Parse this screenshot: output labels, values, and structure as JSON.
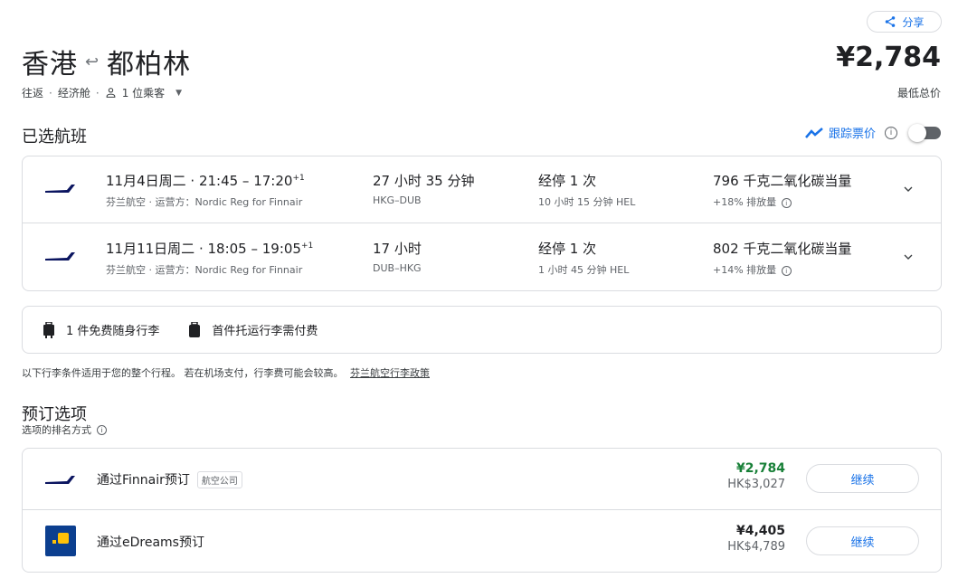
{
  "header": {
    "share_label": "分享",
    "origin": "香港",
    "destination": "都柏林",
    "total_price": "¥2,784",
    "total_price_label": "最低总价"
  },
  "trip": {
    "type": "往返",
    "cabin": "经济舱",
    "passengers": "1 位乘客"
  },
  "selected_flights": {
    "title": "已选航班",
    "track_label": "跟踪票价",
    "track_enabled": false,
    "flights": [
      {
        "date_time": "11月4日周二 · ",
        "times": "21:45 – 17:20",
        "day_offset": "+1",
        "airline": "芬兰航空 · 运营方：Nordic Reg for Finnair",
        "duration": "27 小时 35 分钟",
        "route": "HKG–DUB",
        "stops": "经停 1 次",
        "layover": "10 小时 15 分钟 HEL",
        "emissions": "796 千克二氧化碳当量",
        "emissions_delta": "+18% 排放量"
      },
      {
        "date_time": "11月11日周二 · ",
        "times": "18:05 – 19:05",
        "day_offset": "+1",
        "airline": "芬兰航空 · 运营方：Nordic Reg for Finnair",
        "duration": "17 小时",
        "route": "DUB–HKG",
        "stops": "经停 1 次",
        "layover": "1 小时 45 分钟 HEL",
        "emissions": "802 千克二氧化碳当量",
        "emissions_delta": "+14% 排放量"
      }
    ]
  },
  "baggage": {
    "carry_on": "1 件免费随身行李",
    "checked": "首件托运行李需付费",
    "note": "以下行李条件适用于您的整个行程。 若在机场支付，行李费可能会较高。",
    "policy_link": "芬兰航空行李政策"
  },
  "booking": {
    "title": "预订选项",
    "sort_label": "选项的排名方式",
    "options": [
      {
        "name": "通过Finnair预订",
        "tag": "航空公司",
        "price": "¥2,784",
        "price_local": "HK$3,027",
        "continue_label": "继续"
      },
      {
        "name": "通过eDreams预订",
        "tag": "",
        "price": "¥4,405",
        "price_local": "HK$4,789",
        "continue_label": "继续"
      }
    ]
  },
  "colors": {
    "accent": "#1a73e8",
    "price_green": "#188038",
    "finnair_blue": "#0b1560",
    "edreams_blue": "#0c3f8f",
    "edreams_yellow": "#ffc107"
  },
  "icons": [
    "share-icon",
    "swap-arrows-icon",
    "person-icon",
    "trend-line-icon",
    "info-icon",
    "finnair-logo",
    "chevron-down-icon",
    "carry-on-bag-icon",
    "checked-bag-icon",
    "edreams-logo"
  ]
}
